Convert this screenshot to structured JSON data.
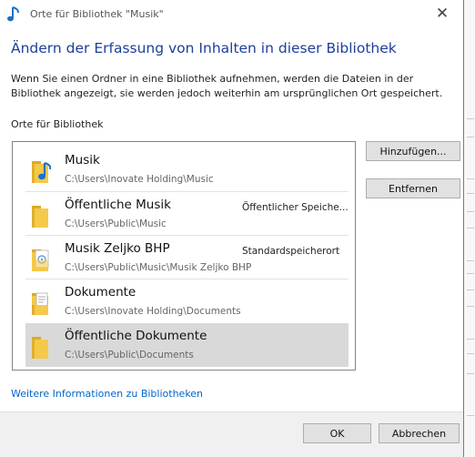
{
  "window": {
    "title": "Orte für Bibliothek \"Musik\"",
    "title_icon": "music-note-icon",
    "close_glyph": "✕"
  },
  "heading": "Ändern der Erfassung von Inhalten in dieser Bibliothek",
  "description": "Wenn Sie einen Ordner in eine Bibliothek aufnehmen, werden die Dateien in der Bibliothek angezeigt, sie werden jedoch weiterhin am ursprünglichen Ort gespeichert.",
  "locations_label": "Orte für Bibliothek",
  "locations": [
    {
      "name": "Musik",
      "path": "C:\\Users\\Inovate Holding\\Music",
      "status": "",
      "icon": "folder-music-icon",
      "selected": false
    },
    {
      "name": "Öffentliche Musik",
      "path": "C:\\Users\\Public\\Music",
      "status": "Öffentlicher Speiche...",
      "icon": "folder-icon",
      "selected": false
    },
    {
      "name": "Musik Zeljko BHP",
      "path": "C:\\Users\\Public\\Music\\Musik Zeljko BHP",
      "status": "Standardspeicherort",
      "icon": "folder-music-file-icon",
      "selected": false
    },
    {
      "name": "Dokumente",
      "path": "C:\\Users\\Inovate Holding\\Documents",
      "status": "",
      "icon": "folder-documents-icon",
      "selected": false
    },
    {
      "name": "Öffentliche Dokumente",
      "path": "C:\\Users\\Public\\Documents",
      "status": "",
      "icon": "folder-icon",
      "selected": true
    }
  ],
  "buttons": {
    "add": "Hinzufügen...",
    "remove": "Entfernen",
    "ok": "OK",
    "cancel": "Abbrechen"
  },
  "more_info_link": "Weitere Informationen zu Bibliotheken",
  "colors": {
    "heading": "#1d3f9a",
    "link": "#0066cc",
    "selection": "#d9d9d9",
    "folder": "#f5c94a",
    "accent": "#1a73c8"
  }
}
